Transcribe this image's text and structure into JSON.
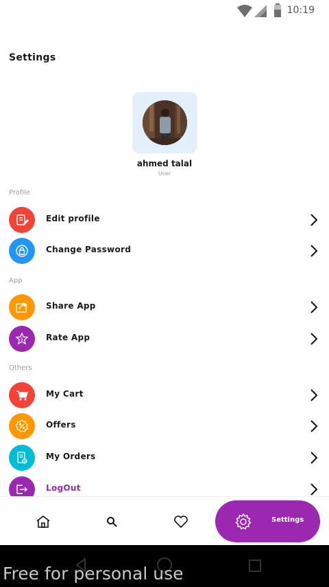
{
  "status_bar": {
    "time": "10:19"
  },
  "page": {
    "title": "Settings"
  },
  "profile": {
    "name": "ahmed talal",
    "role": "User"
  },
  "sections": {
    "profile": "Profile",
    "app": "App",
    "others": "Others"
  },
  "items": {
    "edit_profile": "Edit profile",
    "change_password": "Change Password",
    "share_app": "Share App",
    "rate_app": "Rate App",
    "my_cart": "My Cart",
    "offers": "Offers",
    "my_orders": "My Orders",
    "logout": "LogOut"
  },
  "colors": {
    "red": "#f44336",
    "blue": "#2196f3",
    "orange": "#ff9800",
    "purple": "#9c27b0",
    "cyan": "#00bcd4"
  },
  "bottom_nav": {
    "active_label": "Settings"
  },
  "watermark": "Free for personal use"
}
